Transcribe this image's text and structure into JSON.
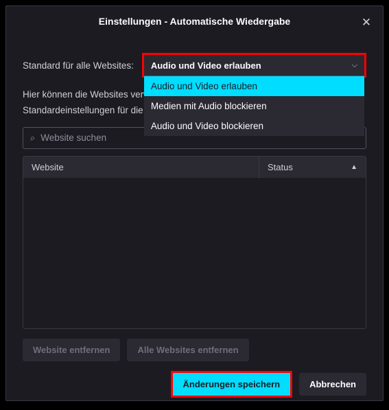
{
  "dialog": {
    "title": "Einstellungen - Automatische Wiedergabe"
  },
  "defaultRow": {
    "label": "Standard für alle Websites:"
  },
  "dropdown": {
    "selected": "Audio und Video erlauben",
    "options": [
      "Audio und Video erlauben",
      "Medien mit Audio blockieren",
      "Audio und Video blockieren"
    ]
  },
  "description": "Hier können die Websites verwaltet werden, welche nicht den Standardeinstellungen für die automatische Wiedergabe folgen.",
  "search": {
    "placeholder": "Website suchen"
  },
  "table": {
    "col_website": "Website",
    "col_status": "Status"
  },
  "buttons": {
    "remove_site": "Website entfernen",
    "remove_all": "Alle Websites entfernen",
    "save": "Änderungen speichern",
    "cancel": "Abbrechen"
  }
}
